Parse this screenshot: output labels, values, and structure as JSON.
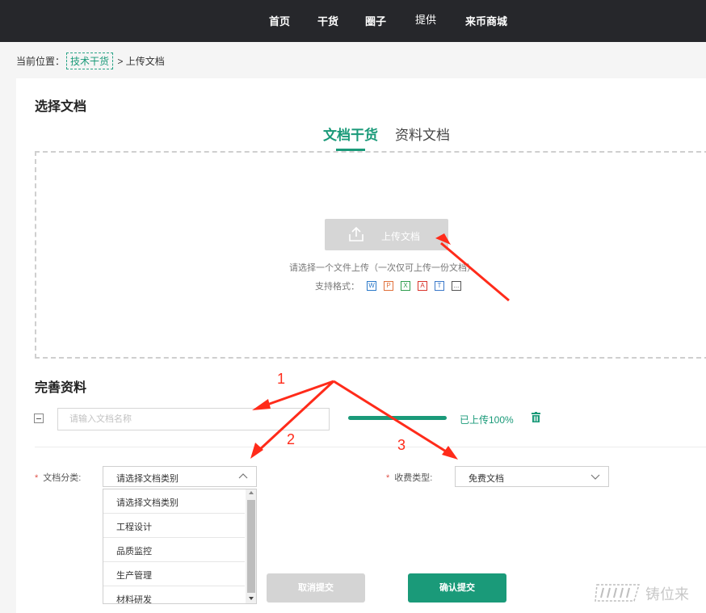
{
  "nav": {
    "items": [
      "首页",
      "干货",
      "圈子",
      "提供",
      "来币商城"
    ]
  },
  "breadcrumb": {
    "prefix": "当前位置：",
    "link": "技术干货",
    "separator": ">",
    "current": "上传文档"
  },
  "select_section": {
    "title": "选择文档",
    "tabs": [
      {
        "label": "文档干货",
        "active": true
      },
      {
        "label": "资料文档",
        "active": false
      }
    ]
  },
  "upload": {
    "button_label": "上传文档",
    "hint": "请选择一个文件上传（一次仅可上传一份文档）",
    "formats_label": "支持格式：",
    "formats": [
      {
        "glyph": "W",
        "color": "#2b79c9"
      },
      {
        "glyph": "P",
        "color": "#e0703a"
      },
      {
        "glyph": "X",
        "color": "#2e9d4e"
      },
      {
        "glyph": "A",
        "color": "#d9342b"
      },
      {
        "glyph": "T",
        "color": "#3a78c9"
      },
      {
        "glyph": "...",
        "color": "#555555"
      }
    ]
  },
  "details_section": {
    "title": "完善资料",
    "doc_name_placeholder": "请输入文档名称",
    "progress_percent": 100,
    "progress_text": "已上传100%",
    "category_label": "文档分类:",
    "category_placeholder": "请选择文档类别",
    "category_options": [
      "请选择文档类别",
      "工程设计",
      "品质监控",
      "生产管理",
      "材料研发"
    ],
    "fee_label": "收费类型:",
    "fee_value": "免费文档"
  },
  "buttons": {
    "cancel": "取消提交",
    "confirm": "确认提交"
  },
  "annotations": {
    "labels": [
      "1",
      "2",
      "3"
    ],
    "color": "#ff2b1a"
  },
  "watermark": {
    "text": "铸位来"
  },
  "colors": {
    "accent": "#1a9a79",
    "topbar": "#26272b"
  }
}
